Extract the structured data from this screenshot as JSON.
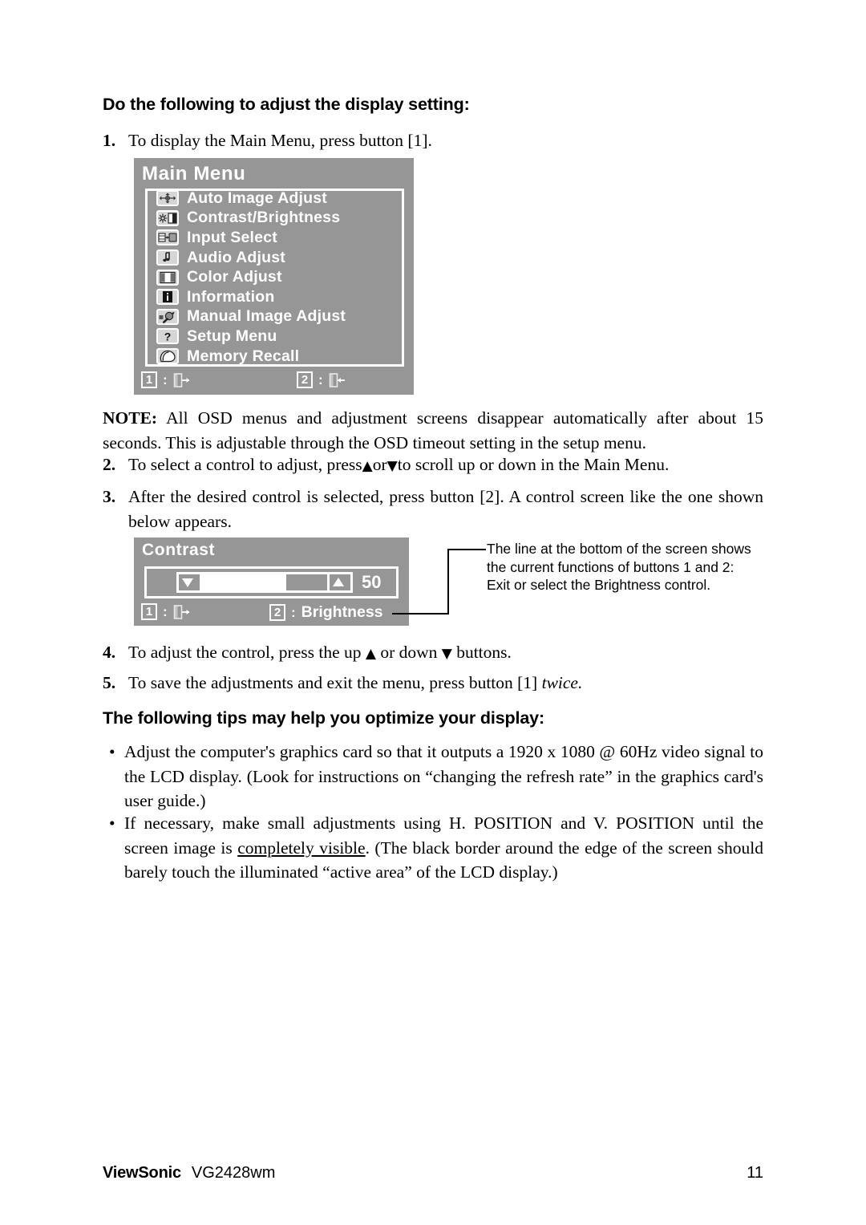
{
  "page": {
    "heading_1": "Do the following to adjust the display setting:",
    "heading_2": "The following tips may help you optimize your display:"
  },
  "steps": [
    {
      "number": "1.",
      "text": "To display the Main Menu, press button [1]."
    },
    {
      "number": "2.",
      "text_before": "To select a control to adjust, press",
      "up_glyph": "▲",
      "text_middle": "or",
      "down_glyph": "▼",
      "text_after": "to scroll up or down in the Main Menu."
    },
    {
      "number": "3.",
      "text": "After the desired control is selected, press button [2]. A control screen like the one shown below appears."
    },
    {
      "number": "4.",
      "text_before": "To adjust the control, press the up",
      "up_glyph": "▲",
      "text_middle": "or down",
      "down_glyph": "▼",
      "text_after": "buttons."
    },
    {
      "number": "5.",
      "text_before": "To save the adjustments and exit the menu, press button [1]",
      "emphasis": "twice",
      "text_after": "."
    }
  ],
  "note": {
    "label": "NOTE:",
    "text": "All OSD menus and adjustment screens disappear automatically after about 15 seconds. This is adjustable through the OSD timeout setting in the setup menu."
  },
  "tips": [
    {
      "bullet": "•",
      "text": "Adjust the computer's graphics card so that it outputs a 1920 x 1080 @ 60Hz video signal to the LCD display. (Look for instructions on “changing the refresh rate” in the graphics card's user guide.)"
    },
    {
      "bullet": "•",
      "part1": "If necessary, make small adjustments using H. POSITION and V. POSITION until the screen image is ",
      "underlined": "completely visible",
      "part2": ". (The black border around the edge of the screen should barely touch the illuminated “active area” of the LCD display.)"
    }
  ],
  "main_menu_osd": {
    "title": "Main Menu",
    "background_color": "#969696",
    "text_color": "#ffffff",
    "items": [
      {
        "icon": "auto-image-adjust-icon",
        "label": "Auto Image Adjust"
      },
      {
        "icon": "contrast-brightness-icon",
        "label": "Contrast/Brightness"
      },
      {
        "icon": "input-select-icon",
        "label": "Input Select"
      },
      {
        "icon": "audio-adjust-icon",
        "label": "Audio Adjust"
      },
      {
        "icon": "color-adjust-icon",
        "label": "Color Adjust"
      },
      {
        "icon": "information-icon",
        "label": "Information"
      },
      {
        "icon": "manual-image-adjust-icon",
        "label": "Manual Image Adjust"
      },
      {
        "icon": "setup-menu-icon",
        "label": "Setup Menu"
      },
      {
        "icon": "memory-recall-icon",
        "label": "Memory Recall"
      }
    ],
    "function_bar": {
      "key1": "1",
      "colon1": ":",
      "icon1": "exit-door-icon",
      "key2": "2",
      "colon2": ":",
      "icon2": "enter-door-icon"
    }
  },
  "contrast_osd": {
    "title": "Contrast",
    "value": "50",
    "fill_percent": 50,
    "down_glyph": "▼",
    "up_glyph": "▲",
    "function_bar": {
      "key1": "1",
      "colon1": ":",
      "icon1": "exit-door-icon",
      "key2": "2",
      "colon2": ":",
      "label2": "Brightness"
    }
  },
  "callout": {
    "line1": "The line at the bottom of the screen shows",
    "line2": "the current functions of buttons 1 and 2:",
    "line3": "Exit or select the Brightness control."
  },
  "footer": {
    "brand": "ViewSonic",
    "model": "VG2428wm",
    "page_number": "11"
  }
}
